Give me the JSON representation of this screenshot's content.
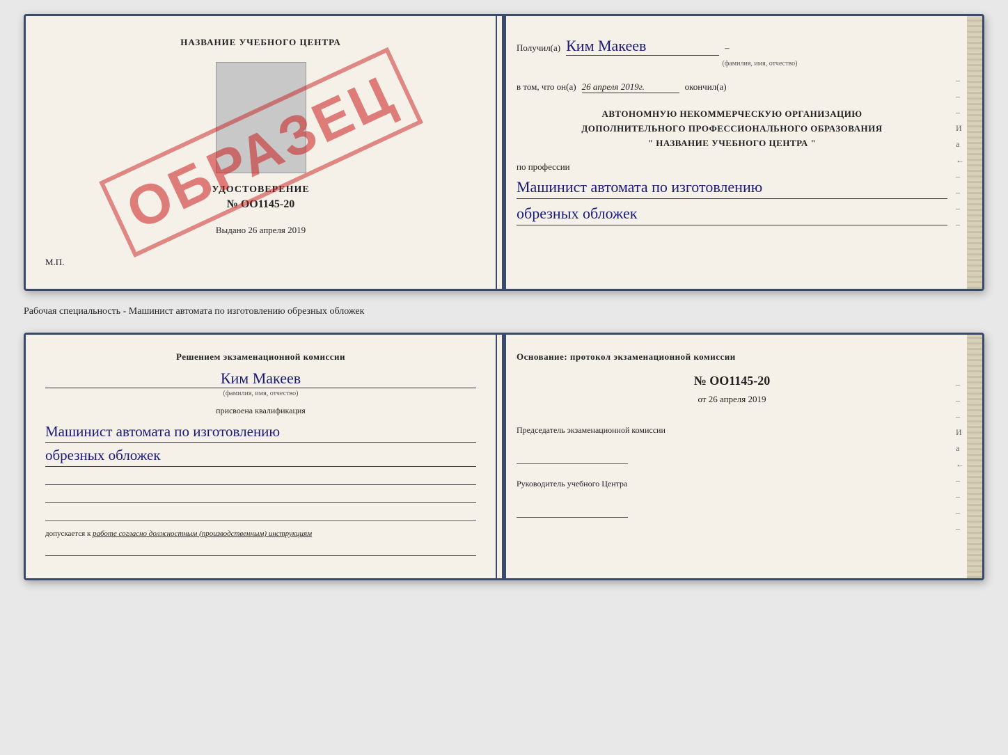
{
  "top_document": {
    "left": {
      "school_name": "НАЗВАНИЕ УЧЕБНОГО ЦЕНТРА",
      "cert_title": "УДОСТОВЕРЕНИЕ",
      "cert_number": "№ OO1145-20",
      "issued_date_label": "Выдано",
      "issued_date_value": "26 апреля 2019",
      "mp_label": "М.П.",
      "watermark": "ОБРАЗЕЦ"
    },
    "right": {
      "received_label": "Получил(а)",
      "received_name": "Ким Макеев",
      "fio_label": "(фамилия, имя, отчество)",
      "date_prefix": "в том, что он(а)",
      "date_value": "26 апреля 2019г.",
      "date_suffix": "окончил(а)",
      "org_line1": "АВТОНОМНУЮ НЕКОММЕРЧЕСКУЮ ОРГАНИЗАЦИЮ",
      "org_line2": "ДОПОЛНИТЕЛЬНОГО ПРОФЕССИОНАЛЬНОГО ОБРАЗОВАНИЯ",
      "org_line3": "\"   НАЗВАНИЕ УЧЕБНОГО ЦЕНТРА   \"",
      "profession_label": "по профессии",
      "profession_line1": "Машинист автомата по изготовлению",
      "profession_line2": "обрезных обложек"
    }
  },
  "separator": {
    "text": "Рабочая специальность - Машинист автомата по изготовлению обрезных обложек"
  },
  "bottom_document": {
    "left": {
      "decision_label": "Решением экзаменационной комиссии",
      "person_name": "Ким Макеев",
      "fio_label": "(фамилия, имя, отчество)",
      "qual_assigned_label": "присвоена квалификация",
      "qual_line1": "Машинист автомата по изготовлению",
      "qual_line2": "обрезных обложек",
      "allowed_prefix": "допускается к",
      "allowed_text": "работе согласно должностным (производственным) инструкциям"
    },
    "right": {
      "basis_label": "Основание: протокол экзаменационной комиссии",
      "protocol_number": "№ OO1145-20",
      "protocol_date_prefix": "от",
      "protocol_date_value": "26 апреля 2019",
      "chairman_label": "Председатель экзаменационной комиссии",
      "director_label": "Руководитель учебного Центра"
    }
  },
  "edge_annotations": [
    "–",
    "–",
    "–",
    "И",
    "а",
    "←",
    "–",
    "–",
    "–",
    "–"
  ]
}
